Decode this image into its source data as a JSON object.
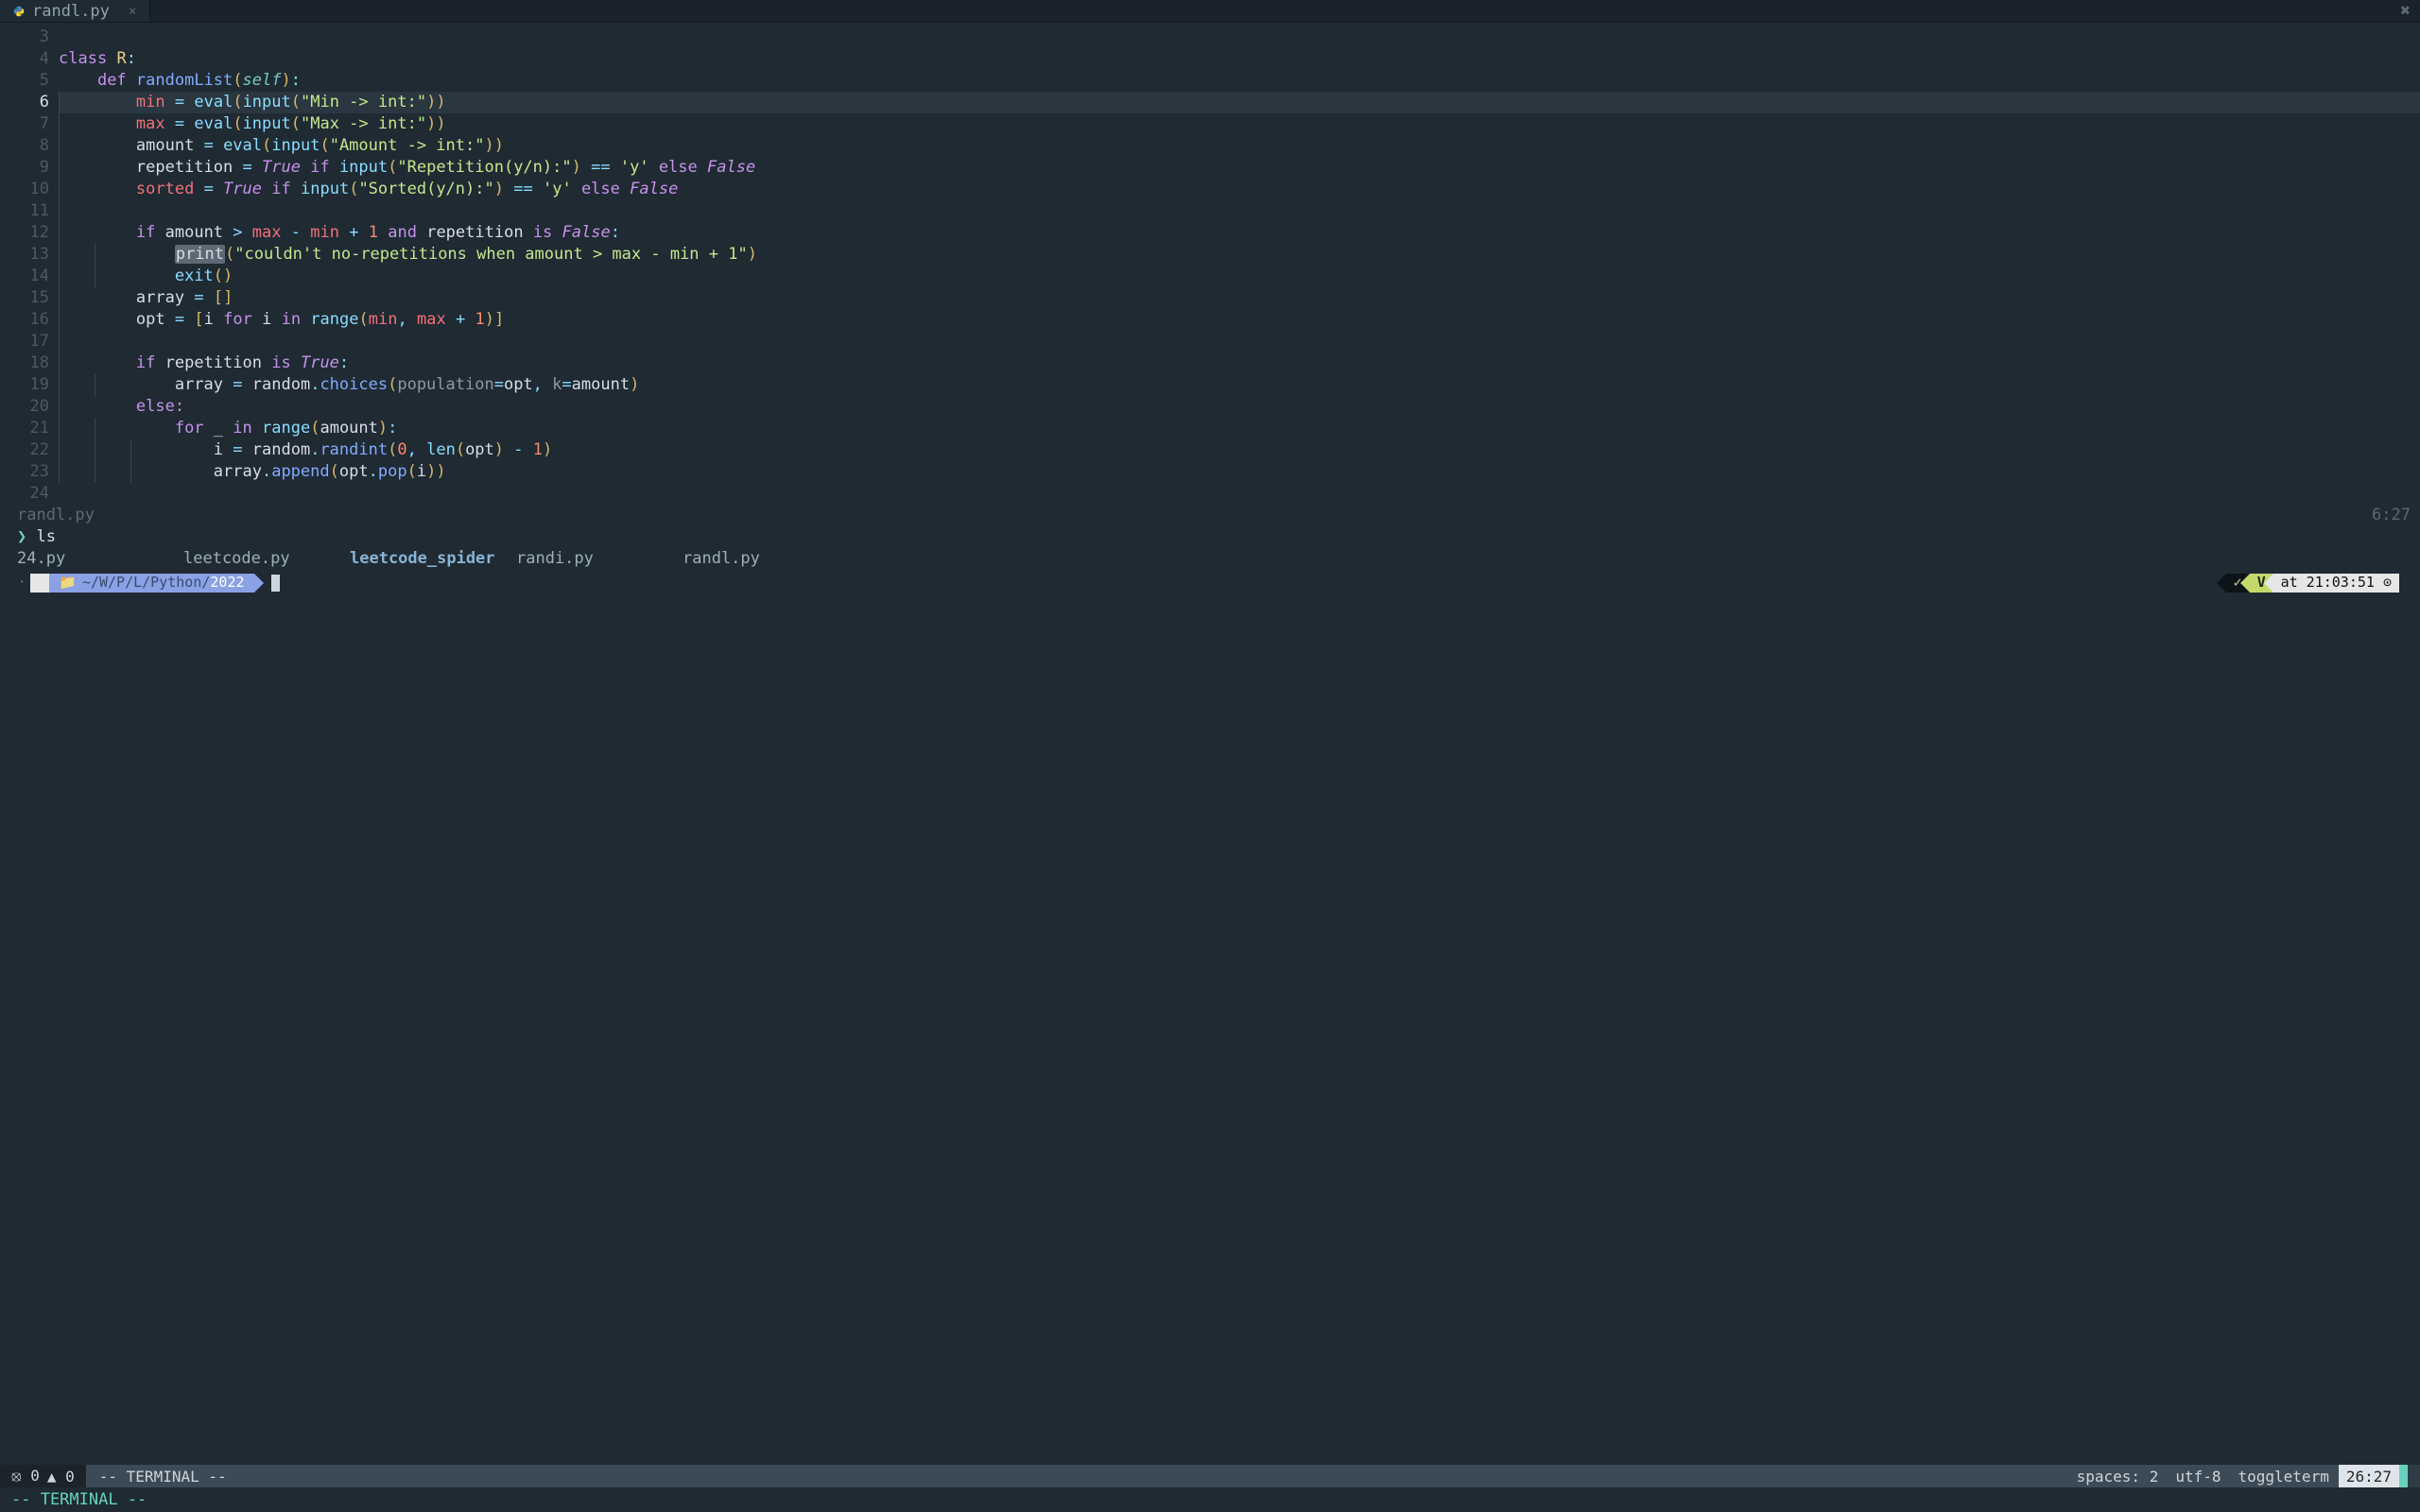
{
  "tab": {
    "filename": "randl.py",
    "close_glyph": "×",
    "window_close_glyph": "✖"
  },
  "editor": {
    "cursor_line": 6,
    "line_numbers": [
      3,
      4,
      5,
      6,
      7,
      8,
      9,
      10,
      11,
      12,
      13,
      14,
      15,
      16,
      17,
      18,
      19,
      20,
      21,
      22,
      23,
      24
    ],
    "tokens": {
      "class_kw": "class",
      "class_name": "R",
      "def_kw": "def",
      "fn_name": "randomList",
      "self": "self",
      "min_id": "min",
      "max_id": "max",
      "amount_id": "amount",
      "rep_id": "repetition",
      "sorted_id": "sorted",
      "array_id": "array",
      "opt_id": "opt",
      "i_id": "i",
      "underscore": "_",
      "eval": "eval",
      "input": "input",
      "print": "print",
      "exit": "exit",
      "range": "range",
      "len": "len",
      "random": "random",
      "choices": "choices",
      "randint": "randint",
      "append": "append",
      "pop": "pop",
      "pop_kw": "population",
      "k_kw": "k",
      "True": "True",
      "False": "False",
      "if": "if",
      "else": "else",
      "elseColon": "else:",
      "for": "for",
      "in": "in",
      "and": "and",
      "is": "is",
      "eq": "=",
      "eqeq": "==",
      "gt": ">",
      "minus": "-",
      "plus": "+",
      "one": "1",
      "zero": "0",
      "s_min": "\"Min -> int:\"",
      "s_max": "\"Max -> int:\"",
      "s_amount": "\"Amount -> int:\"",
      "s_rep": "\"Repetition(y/n):\"",
      "s_sorted": "\"Sorted(y/n):\"",
      "s_y": "'y'",
      "s_err": "\"couldn't no-repetitions when amount > max - min + 1\""
    },
    "buffer_name": "randl.py",
    "buffer_pos": "6:27"
  },
  "terminal": {
    "prompt_caret": "❯",
    "command": "ls",
    "ls": [
      "24.py",
      "leetcode.py",
      "leetcode_spider",
      "randi.py",
      "randl.py"
    ],
    "ls_dir_index": 2,
    "apple_glyph": "",
    "folder_glyph": "📁",
    "path_prefix": "~/W/P/L/Python/",
    "path_cur": "2022",
    "ok_glyph": "✓",
    "vim_glyph": "V",
    "time_label": "at 21:03:51 ⊙"
  },
  "statusbar": {
    "errors": "0",
    "warnings": "0",
    "mode": "-- TERMINAL --",
    "spaces": "spaces: 2",
    "encoding": "utf-8",
    "ft": "toggleterm",
    "pos": "26:27"
  },
  "cmdline": "-- TERMINAL --"
}
